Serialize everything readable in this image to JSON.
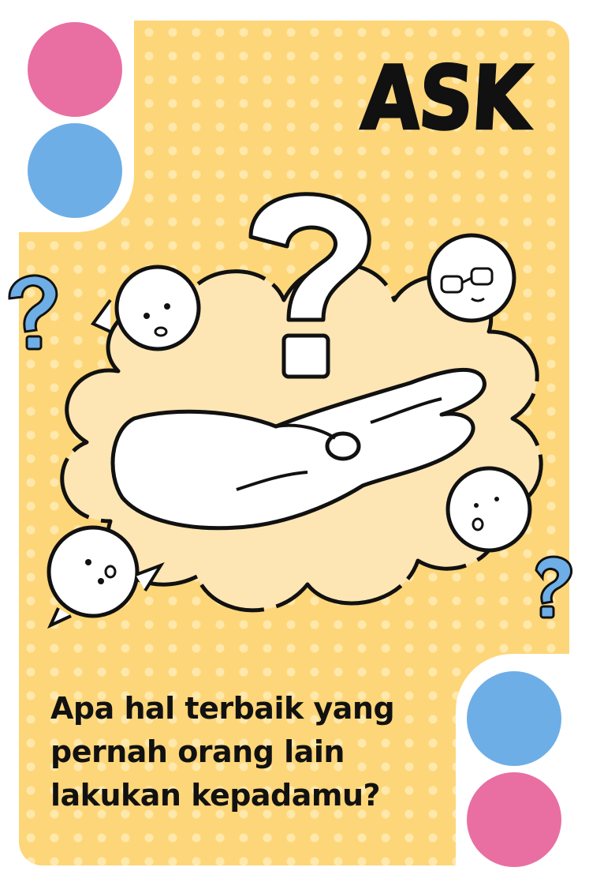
{
  "card": {
    "title": "ASK",
    "question": "Apa hal terbaik yang pernah orang lain lakukan kepadamu?"
  },
  "colors": {
    "background": "#fdd679",
    "accent_pink": "#e96fa2",
    "accent_blue": "#6eaee6",
    "ink": "#111111"
  },
  "icons": [
    "question-mark-icon",
    "open-hand-icon",
    "face-icon",
    "glasses-face-icon"
  ]
}
